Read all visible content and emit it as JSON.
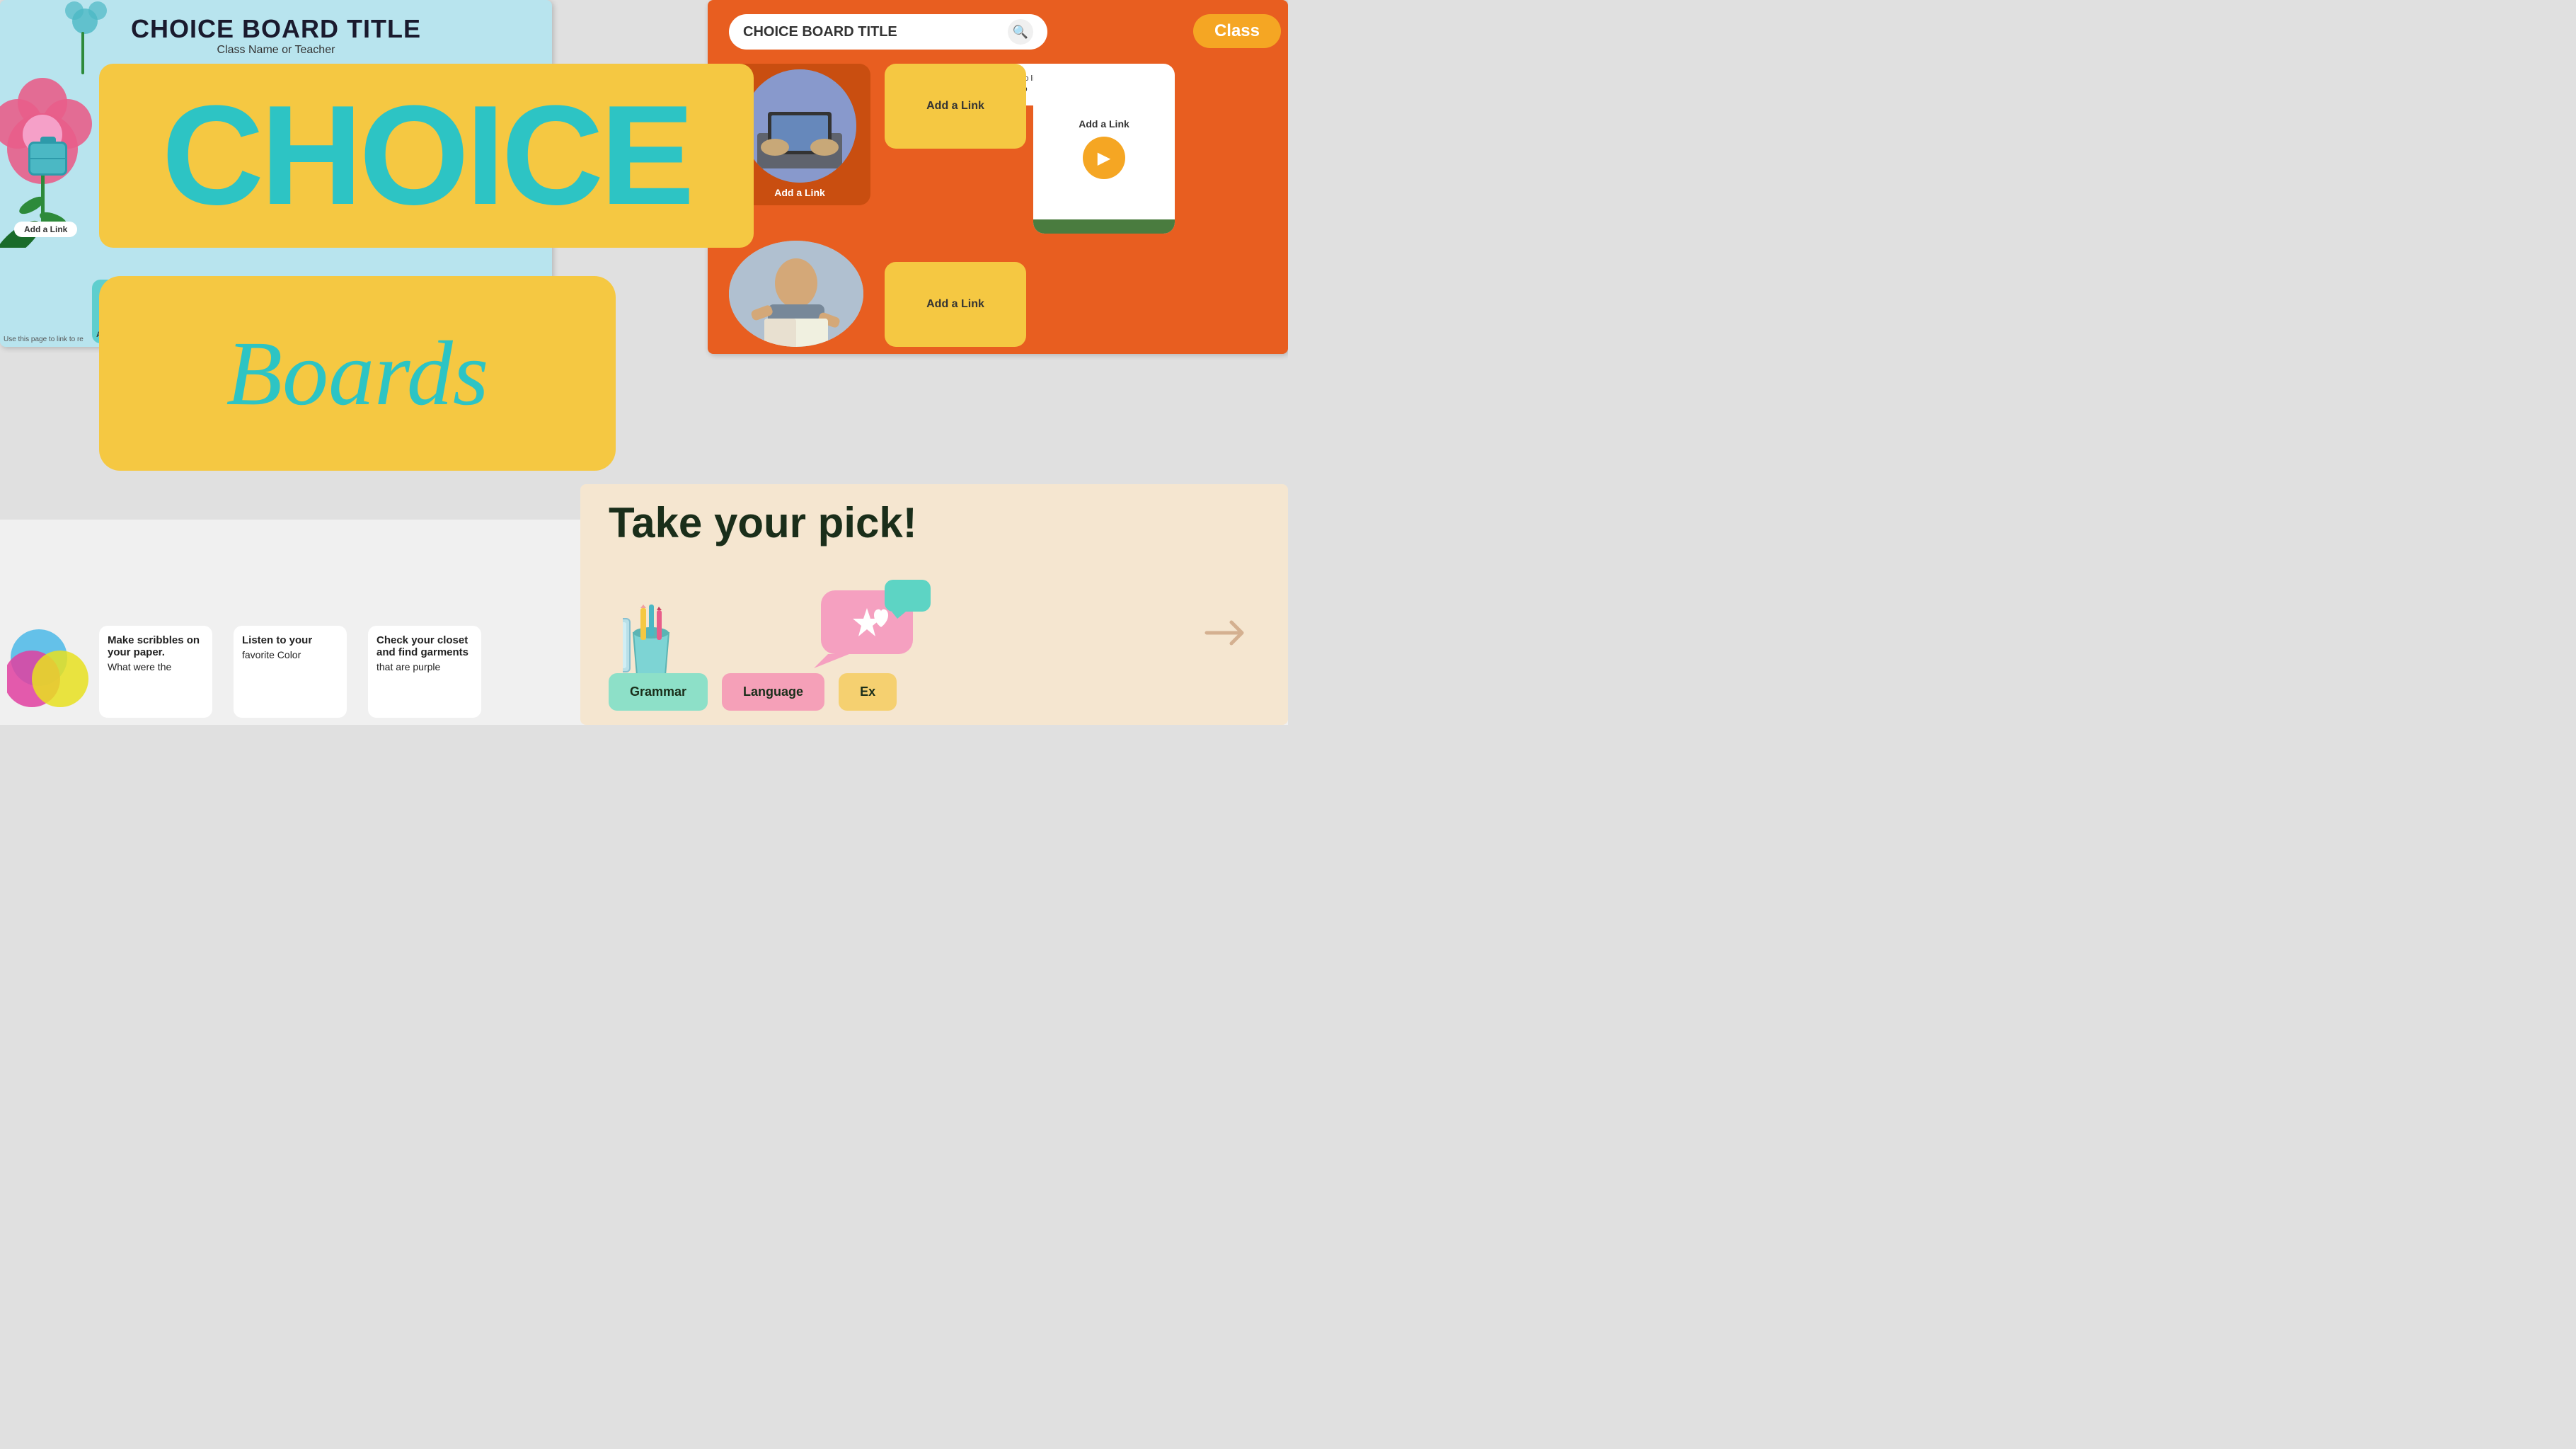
{
  "slides": {
    "slide1": {
      "title": "CHOICE BOARD TITLE",
      "subtitle": "Class Name or Teacher",
      "add_link": "Add a Link"
    },
    "slide_orange": {
      "search_placeholder": "CHOICE BOARD TITLE",
      "class_tab": "Class",
      "info_text": "Use this page to link to r To create a link, highlight the too",
      "add_link_1": "Add a Link",
      "add_link_2": "Add a Link",
      "add_link_3": "Add a Link"
    },
    "slide_bottom_right": {
      "heading": "Take your pick!",
      "btn1": "Grammar",
      "btn2": "Language",
      "btn3": "Ex"
    }
  },
  "banner": {
    "choice": "CHOICE",
    "boards": "Boards"
  },
  "bottom_cards": {
    "card1_title": "Make scribbles on your paper.",
    "card1_sub": "What were the",
    "card2_title": "Listen to your",
    "card2_sub": "favorite Color",
    "card3_title": "Check your closet and find garments",
    "card3_sub": "that are purple"
  },
  "icons": {
    "search": "🔍",
    "play": "▶"
  }
}
